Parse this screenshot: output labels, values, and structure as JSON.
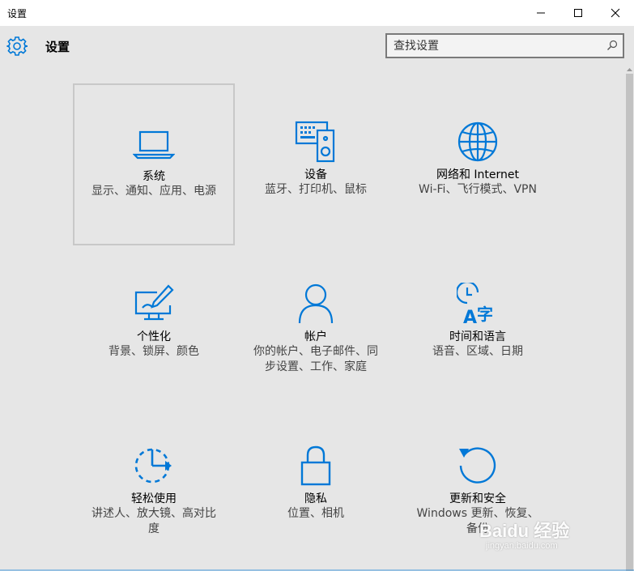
{
  "window": {
    "title": "设置"
  },
  "header": {
    "title": "设置"
  },
  "search": {
    "placeholder": "查找设置"
  },
  "tiles": [
    {
      "icon": "laptop-icon",
      "name": "系统",
      "desc": "显示、通知、应用、电源"
    },
    {
      "icon": "devices-icon",
      "name": "设备",
      "desc": "蓝牙、打印机、鼠标"
    },
    {
      "icon": "globe-icon",
      "name": "网络和 Internet",
      "desc": "Wi-Fi、飞行模式、VPN"
    },
    {
      "icon": "personalize-icon",
      "name": "个性化",
      "desc": "背景、锁屏、颜色"
    },
    {
      "icon": "account-icon",
      "name": "帐户",
      "desc": "你的帐户、电子邮件、同步设置、工作、家庭"
    },
    {
      "icon": "time-language-icon",
      "name": "时间和语言",
      "desc": "语音、区域、日期"
    },
    {
      "icon": "ease-of-access-icon",
      "name": "轻松使用",
      "desc": "讲述人、放大镜、高对比度"
    },
    {
      "icon": "lock-icon",
      "name": "隐私",
      "desc": "位置、相机"
    },
    {
      "icon": "update-icon",
      "name": "更新和安全",
      "desc": "Windows 更新、恢复、备份"
    }
  ],
  "watermark": {
    "brand": "Baidu 经验",
    "url": "jingyan.baidu.com"
  },
  "colors": {
    "accent": "#0078d7",
    "background": "#e6e6e6"
  }
}
